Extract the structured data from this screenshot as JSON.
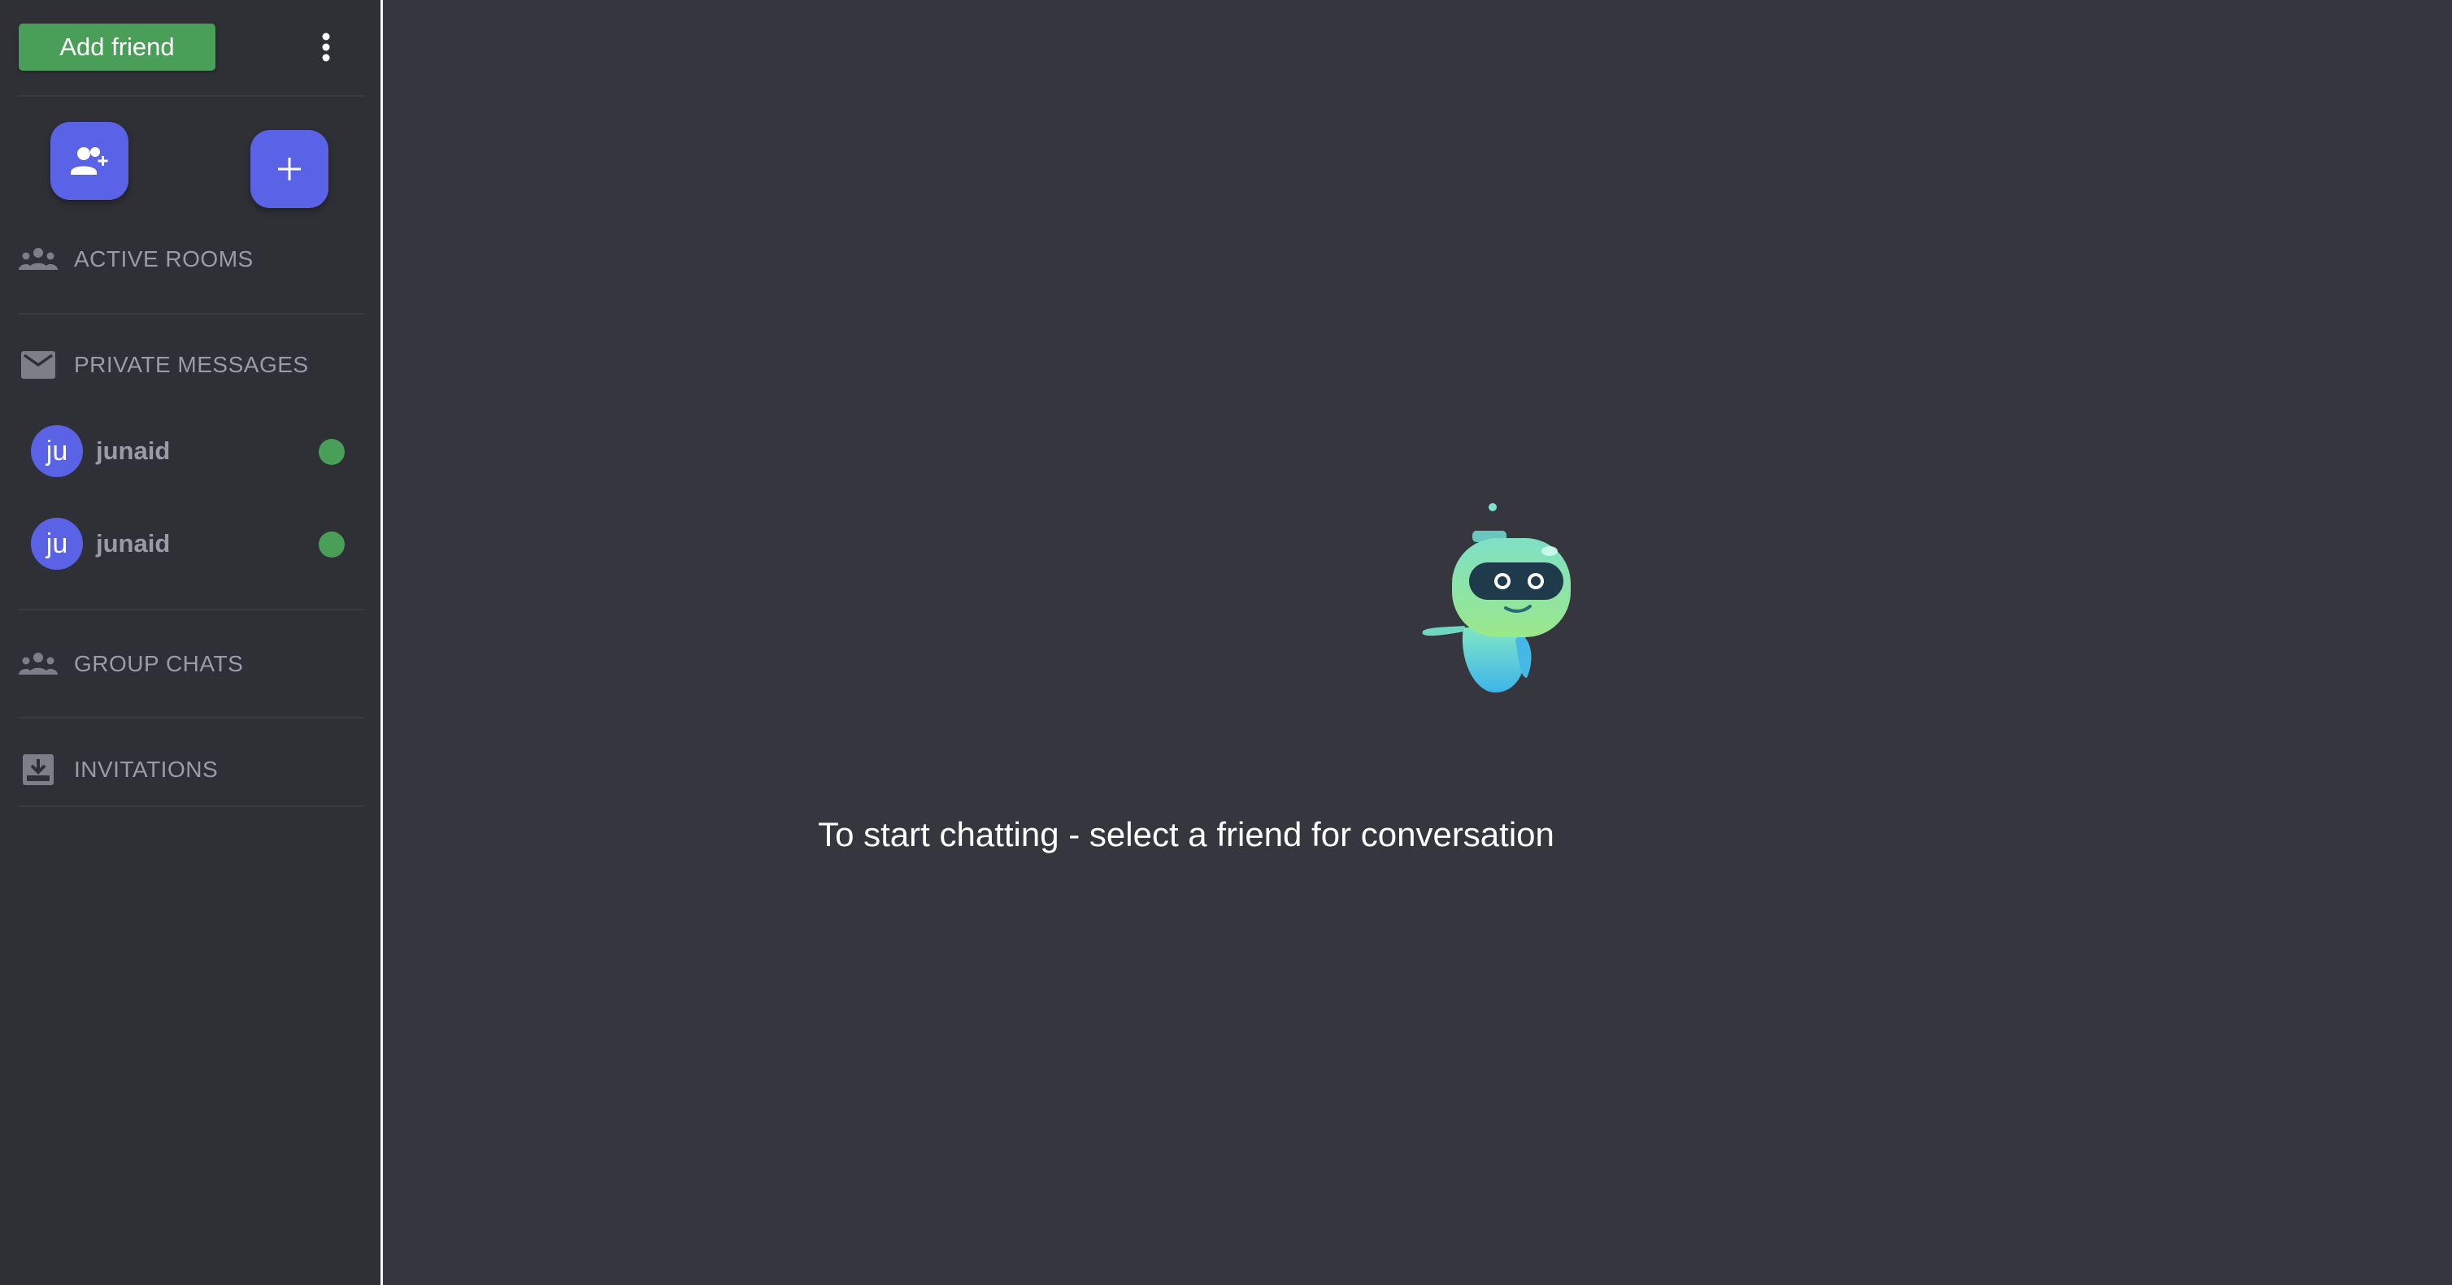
{
  "sidebar": {
    "add_friend_label": "Add friend",
    "sections": {
      "active_rooms": "ACTIVE ROOMS",
      "private_messages": "PRIVATE MESSAGES",
      "group_chats": "GROUP CHATS",
      "invitations": "INVITATIONS"
    },
    "contacts": [
      {
        "initials": "ju",
        "name": "junaid",
        "status": "online"
      },
      {
        "initials": "ju",
        "name": "junaid",
        "status": "online"
      }
    ]
  },
  "main": {
    "empty_state_text": "To start chatting - select a friend for conversation"
  },
  "colors": {
    "accent": "#5a62e6",
    "success": "#4a9f58",
    "sidebar_bg": "#2f3036",
    "main_bg": "#36373e",
    "muted_text": "#9a9ba3"
  },
  "icons": {
    "more": "more-vert-icon",
    "add_user": "person-add-icon",
    "add": "plus-icon",
    "rooms": "groups-icon",
    "messages": "mail-icon",
    "groups": "groups-icon",
    "invitations": "inbox-download-icon"
  }
}
